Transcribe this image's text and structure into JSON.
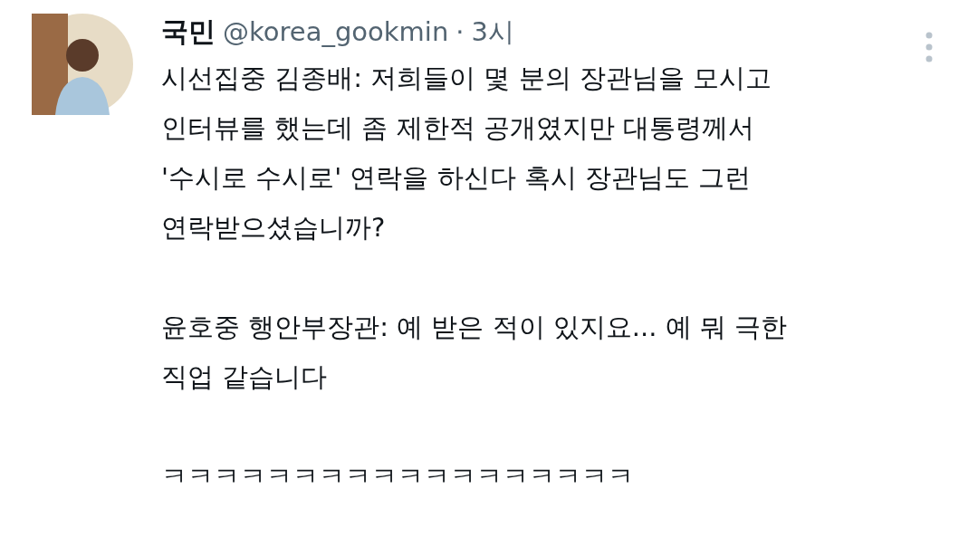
{
  "tweet": {
    "display_name": "국민",
    "handle": "@korea_gookmin",
    "separator": "·",
    "time": "3시",
    "paragraphs": [
      "시선집중 김종배: 저희들이 몇 분의 장관님을 모시고\n인터뷰를 했는데 좀 제한적 공개였지만 대통령께서\n'수시로 수시로' 연락을 하신다 혹시 장관님도 그런\n연락받으셨습니까?",
      "윤호중 행안부장관: 예 받은 적이 있지요... 예 뭐 극한\n직업 같습니다",
      "ㅋㅋㅋㅋㅋㅋㅋㅋㅋㅋㅋㅋㅋㅋㅋㅋㅋㅋ"
    ]
  }
}
